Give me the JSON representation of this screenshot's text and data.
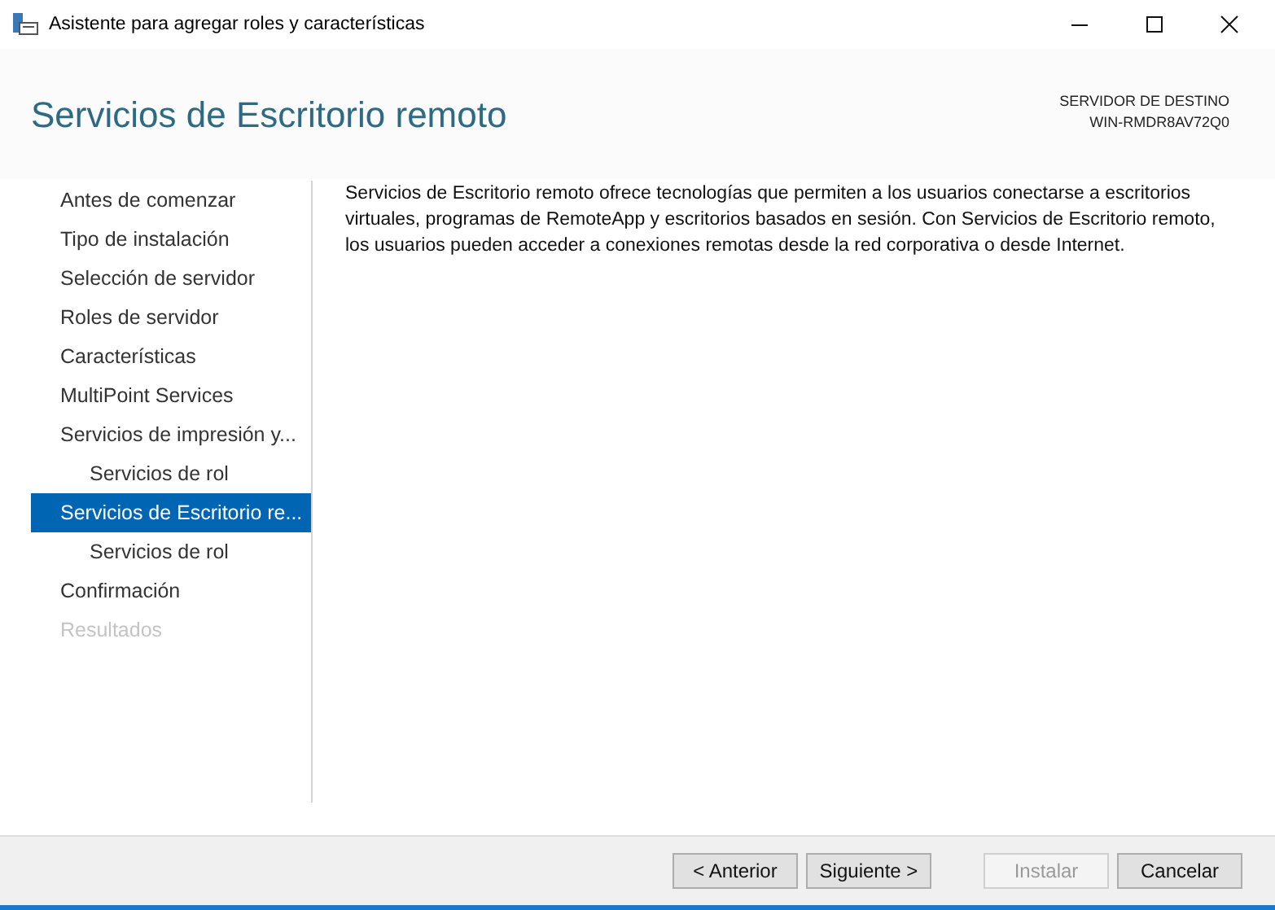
{
  "window": {
    "title": "Asistente para agregar roles y características"
  },
  "header": {
    "title": "Servicios de Escritorio remoto",
    "server_label": "SERVIDOR DE DESTINO",
    "server_name": "WIN-RMDR8AV72Q0"
  },
  "steps": [
    {
      "label": "Antes de comenzar",
      "selected": false,
      "disabled": false
    },
    {
      "label": "Tipo de instalación",
      "selected": false,
      "disabled": false
    },
    {
      "label": "Selección de servidor",
      "selected": false,
      "disabled": false
    },
    {
      "label": "Roles de servidor",
      "selected": false,
      "disabled": false
    },
    {
      "label": "Características",
      "selected": false,
      "disabled": false
    },
    {
      "label": "MultiPoint Services",
      "selected": false,
      "disabled": false
    },
    {
      "label": "Servicios de impresión y...",
      "selected": false,
      "disabled": false,
      "children": [
        {
          "label": "Servicios de rol",
          "selected": false,
          "disabled": false
        }
      ]
    },
    {
      "label": "Servicios de Escritorio re...",
      "selected": true,
      "disabled": false,
      "children": [
        {
          "label": "Servicios de rol",
          "selected": false,
          "disabled": false
        }
      ]
    },
    {
      "label": "Confirmación",
      "selected": false,
      "disabled": false
    },
    {
      "label": "Resultados",
      "selected": false,
      "disabled": true
    }
  ],
  "description": "Servicios de Escritorio remoto ofrece tecnologías que permiten a los usuarios conectarse a escritorios virtuales, programas de RemoteApp y escritorios basados en sesión. Con Servicios de Escritorio remoto, los usuarios pueden acceder a conexiones remotas desde la red corporativa o desde Internet.",
  "buttons": [
    {
      "label": "< Anterior",
      "disabled": false
    },
    {
      "label": "Siguiente >",
      "disabled": false
    },
    {
      "label": "Instalar",
      "disabled": true
    },
    {
      "label": "Cancelar",
      "disabled": false
    }
  ]
}
